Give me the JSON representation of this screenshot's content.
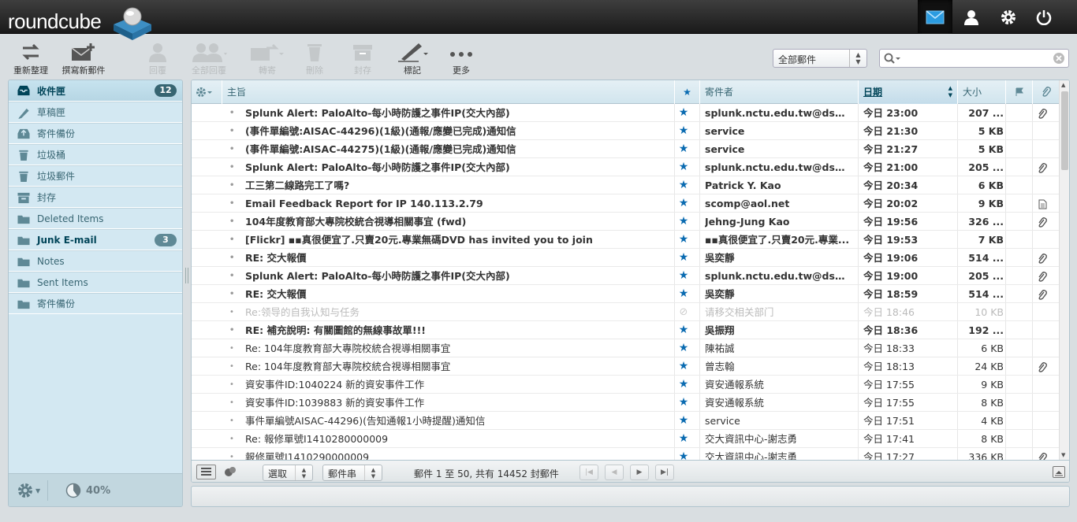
{
  "app": {
    "logo_text": "roundcube"
  },
  "topnav": [
    {
      "name": "mail-icon",
      "selected": true
    },
    {
      "name": "contacts-icon",
      "selected": false
    },
    {
      "name": "settings-icon",
      "selected": false
    },
    {
      "name": "logout-icon",
      "selected": false
    }
  ],
  "toolbar": {
    "refresh": "重新整理",
    "compose": "撰寫新郵件",
    "reply": "回覆",
    "reply_all": "全部回覆",
    "forward": "轉寄",
    "delete": "刪除",
    "archive": "封存",
    "mark": "標記",
    "more": "更多"
  },
  "filter": {
    "selected": "全部郵件"
  },
  "search": {
    "placeholder": ""
  },
  "folders": [
    {
      "label": "收件匣",
      "icon": "inbox-icon",
      "count": "12",
      "selected": true,
      "unread": true
    },
    {
      "label": "草稿匣",
      "icon": "pencil-icon",
      "count": "",
      "selected": false,
      "unread": false
    },
    {
      "label": "寄件備份",
      "icon": "sent-icon",
      "count": "",
      "selected": false,
      "unread": false
    },
    {
      "label": "垃圾桶",
      "icon": "trash-icon",
      "count": "",
      "selected": false,
      "unread": false
    },
    {
      "label": "垃圾郵件",
      "icon": "junk-icon",
      "count": "",
      "selected": false,
      "unread": false
    },
    {
      "label": "封存",
      "icon": "archive-icon",
      "count": "",
      "selected": false,
      "unread": false
    },
    {
      "label": "Deleted Items",
      "icon": "folder-icon",
      "count": "",
      "selected": false,
      "unread": false
    },
    {
      "label": "Junk E-mail",
      "icon": "folder-icon",
      "count": "3",
      "selected": false,
      "unread": true
    },
    {
      "label": "Notes",
      "icon": "folder-icon",
      "count": "",
      "selected": false,
      "unread": false
    },
    {
      "label": "Sent Items",
      "icon": "folder-icon",
      "count": "",
      "selected": false,
      "unread": false
    },
    {
      "label": "寄件備份",
      "icon": "folder-icon",
      "count": "",
      "selected": false,
      "unread": false
    }
  ],
  "quota": {
    "text": "40%",
    "value": 0.4
  },
  "list": {
    "columns": {
      "subject": "主旨",
      "from": "寄件者",
      "date": "日期",
      "size": "大小"
    },
    "messages": [
      {
        "subject": "Splunk Alert: PaloAlto-每小時防護之事件IP(交大內部)",
        "from": "splunk.nctu.edu.tw@dspa...",
        "date": "今日 23:00",
        "size": "207 ...",
        "unread": true,
        "deleted": false,
        "attach": "paperclip-icon"
      },
      {
        "subject": "(事件單編號:AISAC-44296)(1級)(通報/應變已完成)通知信",
        "from": "service",
        "date": "今日 21:30",
        "size": "5 KB",
        "unread": true,
        "deleted": false,
        "attach": ""
      },
      {
        "subject": "(事件單編號:AISAC-44275)(1級)(通報/應變已完成)通知信",
        "from": "service",
        "date": "今日 21:27",
        "size": "5 KB",
        "unread": true,
        "deleted": false,
        "attach": ""
      },
      {
        "subject": "Splunk Alert: PaloAlto-每小時防護之事件IP(交大內部)",
        "from": "splunk.nctu.edu.tw@dspa...",
        "date": "今日 21:00",
        "size": "205 ...",
        "unread": true,
        "deleted": false,
        "attach": "paperclip-icon"
      },
      {
        "subject": "工三第二線路完工了嗎?",
        "from": "Patrick Y. Kao",
        "date": "今日 20:34",
        "size": "6 KB",
        "unread": true,
        "deleted": false,
        "attach": ""
      },
      {
        "subject": "Email Feedback Report for IP 140.113.2.79",
        "from": "scomp@aol.net",
        "date": "今日 20:02",
        "size": "9 KB",
        "unread": true,
        "deleted": false,
        "attach": "document-icon"
      },
      {
        "subject": "104年度教育部大專院校統合視導相關事宜 (fwd)",
        "from": "Jehng-Jung Kao",
        "date": "今日 19:56",
        "size": "326 ...",
        "unread": true,
        "deleted": false,
        "attach": "paperclip-icon"
      },
      {
        "subject": "[Flickr] ▪▪真很便宜了.只賣20元.專業無碼DVD has invited you to join",
        "from": "▪▪真很便宜了.只賣20元.專業...",
        "date": "今日 19:53",
        "size": "7 KB",
        "unread": true,
        "deleted": false,
        "attach": ""
      },
      {
        "subject": "RE: 交大報價",
        "from": "吳奕靜",
        "date": "今日 19:06",
        "size": "514 ...",
        "unread": true,
        "deleted": false,
        "attach": "paperclip-icon"
      },
      {
        "subject": "Splunk Alert: PaloAlto-每小時防護之事件IP(交大內部)",
        "from": "splunk.nctu.edu.tw@dspa...",
        "date": "今日 19:00",
        "size": "205 ...",
        "unread": true,
        "deleted": false,
        "attach": "paperclip-icon"
      },
      {
        "subject": "RE: 交大報價",
        "from": "吳奕靜",
        "date": "今日 18:59",
        "size": "514 ...",
        "unread": true,
        "deleted": false,
        "attach": "paperclip-icon"
      },
      {
        "subject": "Re:领导的自我认知与任务",
        "from": "请移交相关部门",
        "date": "今日 18:46",
        "size": "10 KB",
        "unread": false,
        "deleted": true,
        "attach": ""
      },
      {
        "subject": "RE: 補充說明: 有關圖館的無線事故單!!!",
        "from": "吳振翔",
        "date": "今日 18:36",
        "size": "192 ...",
        "unread": true,
        "deleted": false,
        "attach": ""
      },
      {
        "subject": "Re: 104年度教育部大專院校統合視導相關事宜",
        "from": "陳祐誠",
        "date": "今日 18:33",
        "size": "6 KB",
        "unread": false,
        "deleted": false,
        "attach": ""
      },
      {
        "subject": "Re: 104年度教育部大專院校統合視導相關事宜",
        "from": "曾志翰",
        "date": "今日 18:13",
        "size": "24 KB",
        "unread": false,
        "deleted": false,
        "attach": "paperclip-icon"
      },
      {
        "subject": "資安事件ID:1040224 新的資安事件工作",
        "from": "資安通報系統",
        "date": "今日 17:55",
        "size": "9 KB",
        "unread": false,
        "deleted": false,
        "attach": ""
      },
      {
        "subject": "資安事件ID:1039883 新的資安事件工作",
        "from": "資安通報系統",
        "date": "今日 17:55",
        "size": "8 KB",
        "unread": false,
        "deleted": false,
        "attach": ""
      },
      {
        "subject": "事件單編號AISAC-44296)(告知通報1小時提醒)通知信",
        "from": "service",
        "date": "今日 17:51",
        "size": "4 KB",
        "unread": false,
        "deleted": false,
        "attach": ""
      },
      {
        "subject": "Re: 報修單號I1410280000009",
        "from": "交大資訊中心-謝志勇",
        "date": "今日 17:41",
        "size": "8 KB",
        "unread": false,
        "deleted": false,
        "attach": ""
      },
      {
        "subject": "報修單號I1410290000009",
        "from": "交大資訊中心-謝志勇",
        "date": "今日 17:27",
        "size": "336 KB",
        "unread": false,
        "deleted": false,
        "attach": "paperclip-icon"
      }
    ]
  },
  "footer": {
    "select_label": "選取",
    "threads_label": "郵件串",
    "count_text": "郵件 1 至 50, 共有 14452 封郵件"
  },
  "colors": {
    "accent": "#0a6bb1",
    "folder_text": "#376572",
    "badge": "#376572"
  }
}
